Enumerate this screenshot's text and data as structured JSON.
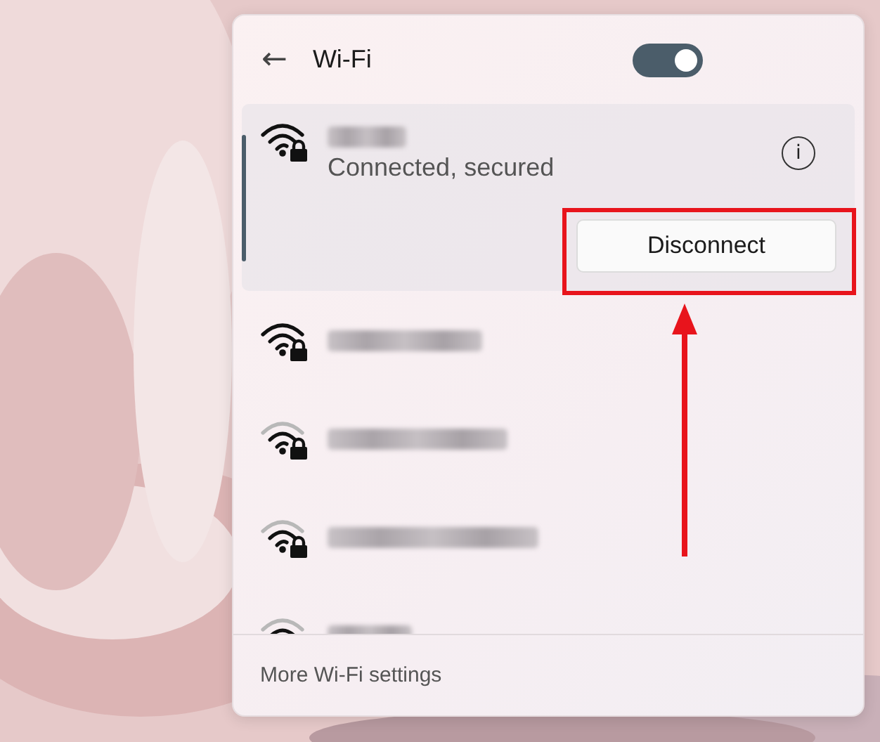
{
  "panel": {
    "back": "←",
    "title": "Wi-Fi",
    "toggle": {
      "on": true
    }
  },
  "connected": {
    "kind": "strong",
    "secured": true,
    "status": "Connected, secured",
    "info": "i",
    "button": "Disconnect"
  },
  "networks": [
    {
      "kind": "strong",
      "secured": true
    },
    {
      "kind": "weak",
      "secured": true
    },
    {
      "kind": "weak",
      "secured": true
    },
    {
      "kind": "weak"
    }
  ],
  "footer": {
    "link": "More Wi-Fi settings"
  }
}
